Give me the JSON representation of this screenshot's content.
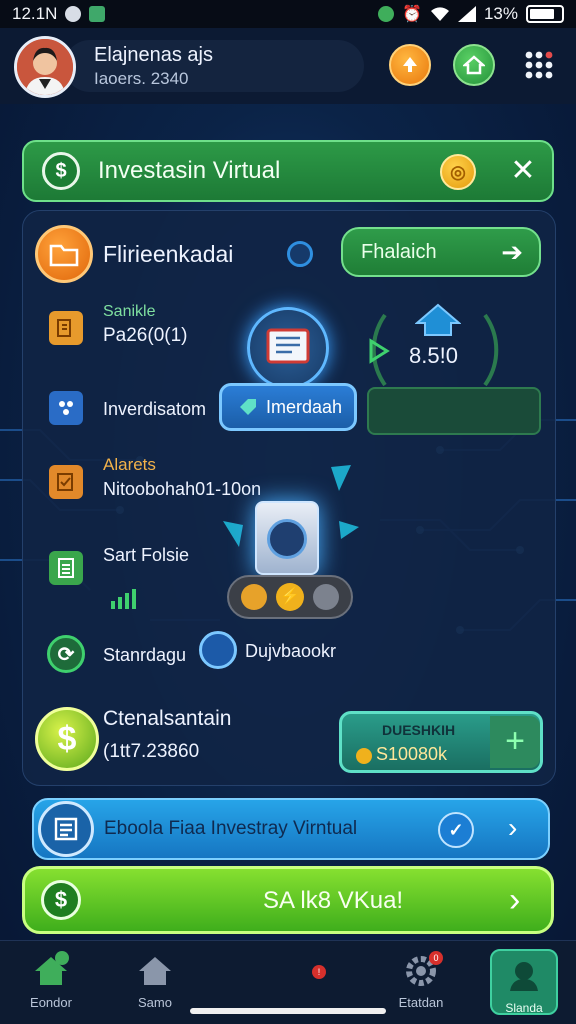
{
  "status_bar": {
    "time": "12.1N",
    "battery": "13%"
  },
  "header": {
    "user_name": "Elajnenas ajs",
    "user_sub": "Iaoers. 2340"
  },
  "banner": {
    "title": "Investasin Virtual"
  },
  "card": {
    "section_title": "Flirieenkadai",
    "action_button": "Fhalaich",
    "item1_label": "Sanikle",
    "item1_value": "Pa26(0(1)",
    "gauge_value": "8.5!0",
    "item2_label": "Inverdisatom",
    "center_button": "Imerdaah",
    "item3_label": "Alarets",
    "item3_value": "Nitoobohah01-10on",
    "item4_label": "Sart Folsie",
    "item5_label": "Stanrdagu",
    "item5_extra": "Dujvbaookr",
    "total_label": "Ctenalsantain",
    "total_value": "(1tt7.23860",
    "deposit_title": "DUESHKIH",
    "deposit_value": "S10080k"
  },
  "info_bar": {
    "text": "Eboola Fiaa Investray Virntual"
  },
  "cta": {
    "label": "SA lk8 VKua!"
  },
  "bottom_nav": {
    "items": [
      "Eondor",
      "Samo",
      "",
      "Etatdan",
      "Slanda"
    ]
  },
  "colors": {
    "accent_green": "#2d9a47",
    "accent_blue": "#1f8fd6",
    "orange": "#f29a1f",
    "background": "#0b2347"
  }
}
